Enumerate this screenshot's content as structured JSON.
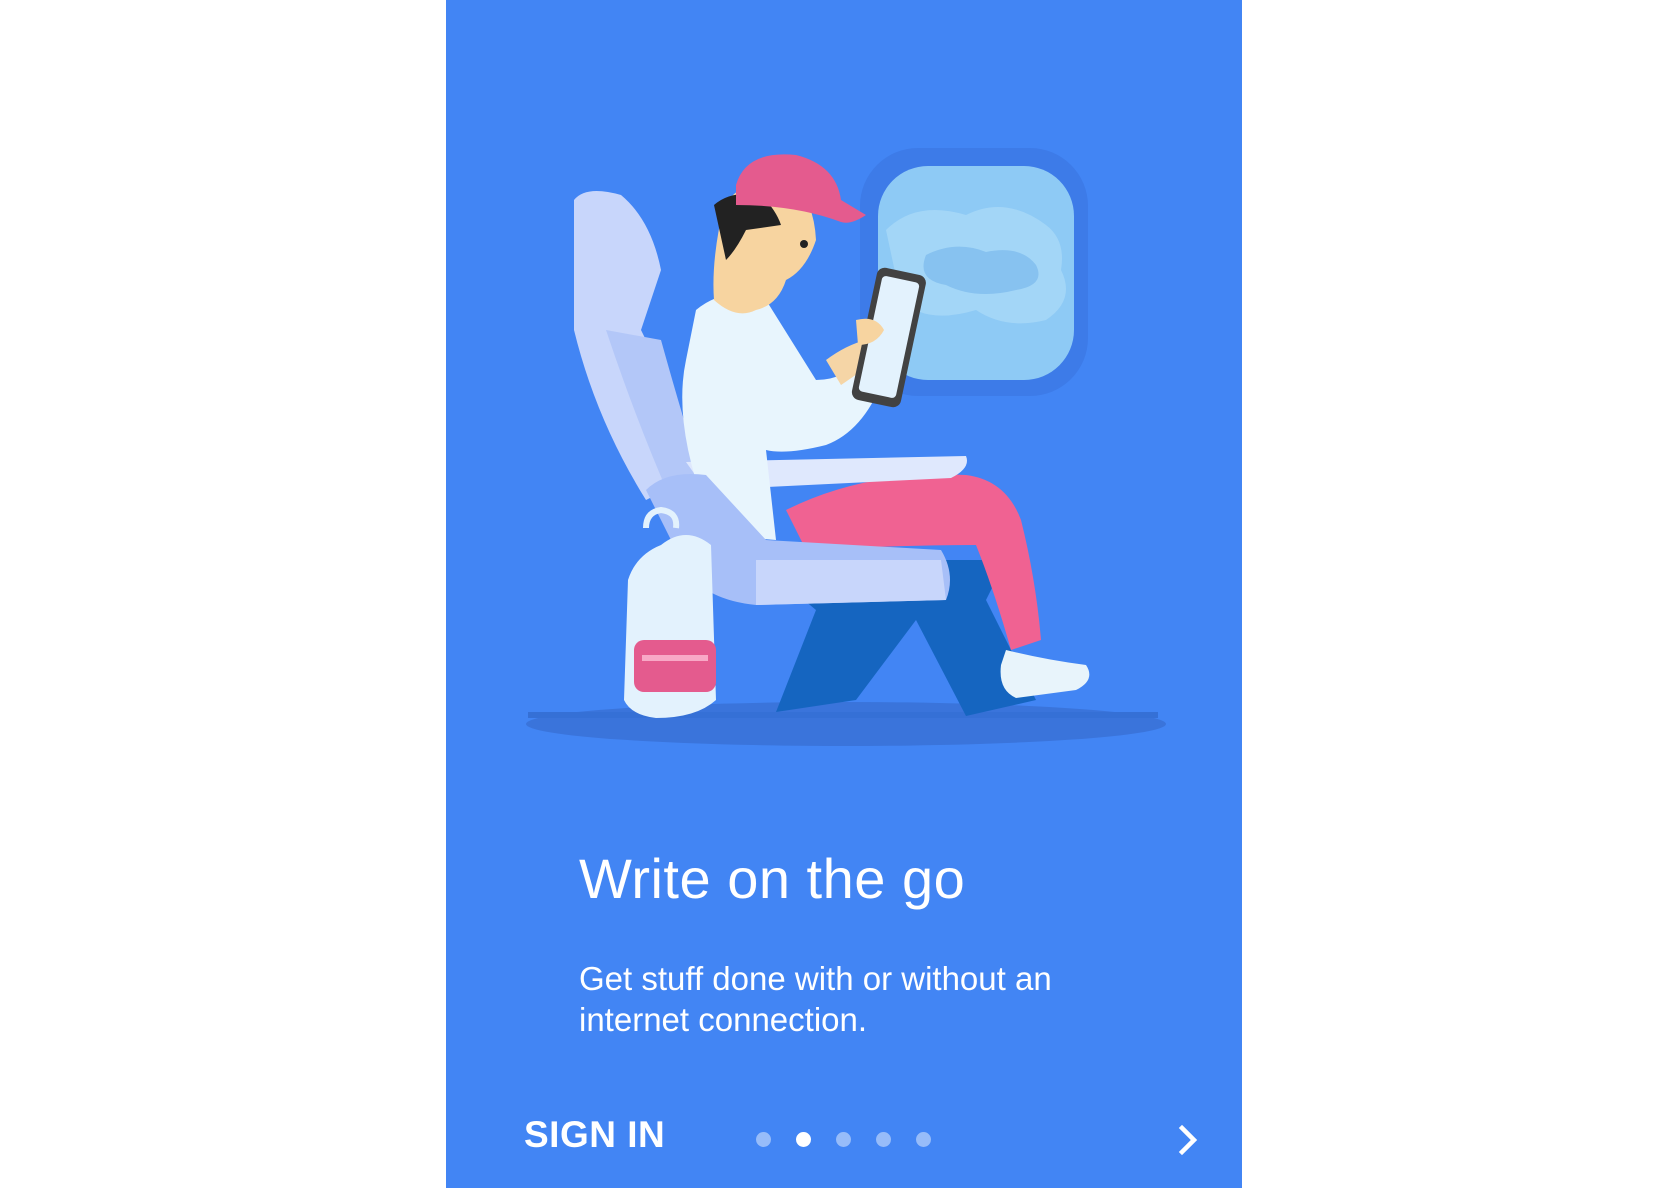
{
  "onboarding": {
    "title": "Write on the go",
    "subtitle": "Get stuff done with or without an internet connection.",
    "sign_in_label": "SIGN IN",
    "page_index": 2,
    "page_count": 5,
    "next_icon": "chevron-right-icon"
  },
  "colors": {
    "background": "#4285f4",
    "text": "#ffffff"
  }
}
